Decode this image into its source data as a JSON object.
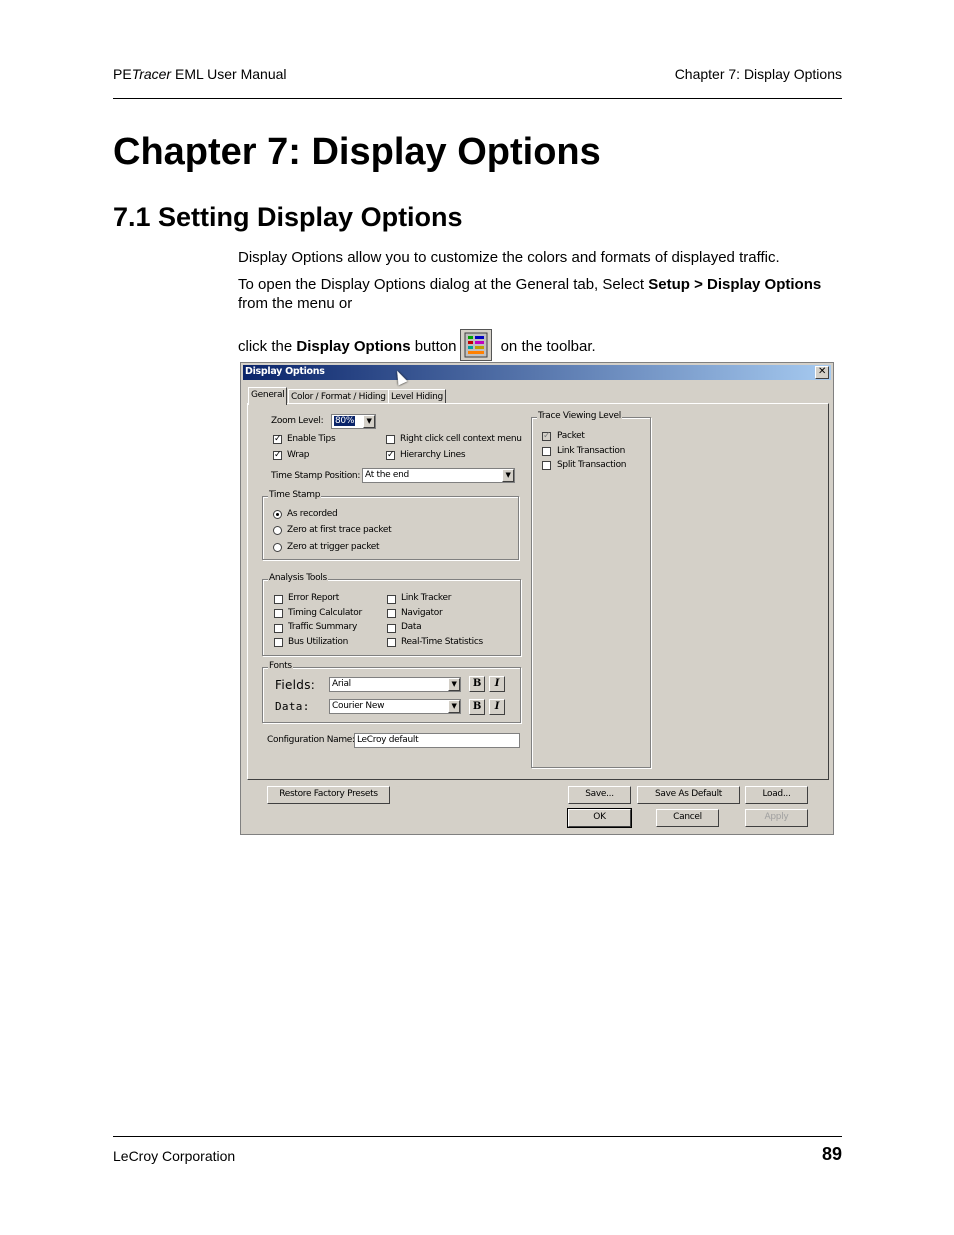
{
  "header": {
    "left_prefix": "PE",
    "left_italic": "Tracer",
    "left_suffix": " EML User Manual",
    "right": "Chapter 7: Display Options"
  },
  "chapter_title": "Chapter 7:  Display Options",
  "section_title": "7.1 Setting Display Options",
  "body": {
    "p1": "Display Options allow you to customize the colors and formats of displayed traffic.",
    "p2_a": "To open the Display Options dialog at the General tab, Select ",
    "p2_b": "Setup > Display Options",
    "p2_c": " from the menu or",
    "p3_a": "click the ",
    "p3_b": "Display Options",
    "p3_c": " button",
    "p3_d": " on the toolbar."
  },
  "dialog": {
    "title": "Display Options",
    "close": "✕",
    "tabs": [
      "General",
      "Color / Format / Hiding",
      "Level Hiding"
    ],
    "zoom_label": "Zoom Level:",
    "zoom_value": "80%",
    "checks_left": [
      {
        "label": "Enable Tips",
        "checked": true
      },
      {
        "label": "Wrap",
        "checked": true
      }
    ],
    "checks_right": [
      {
        "label": "Right click cell context menu",
        "checked": false
      },
      {
        "label": "Hierarchy Lines",
        "checked": true
      }
    ],
    "timestamp_pos_label": "Time Stamp Position:",
    "timestamp_pos_value": "At the end",
    "timestamp_group": {
      "title": "Time Stamp",
      "options": [
        {
          "label": "As recorded",
          "selected": true
        },
        {
          "label": "Zero at first trace packet",
          "selected": false
        },
        {
          "label": "Zero at trigger packet",
          "selected": false
        }
      ]
    },
    "analysis_group": {
      "title": "Analysis Tools",
      "left": [
        "Error Report",
        "Timing Calculator",
        "Traffic Summary",
        "Bus Utilization"
      ],
      "right": [
        "Link Tracker",
        "Navigator",
        "Data",
        "Real-Time Statistics"
      ]
    },
    "fonts_group": {
      "title": "Fonts",
      "fields_label": "Fields:",
      "fields_value": "Arial",
      "data_label": "Data:",
      "data_value": "Courier New",
      "bold": "B",
      "italic": "I"
    },
    "config_label": "Configuration Name:",
    "config_value": "LeCroy default",
    "trace_group": {
      "title": "Trace Viewing Level",
      "options": [
        {
          "label": "Packet",
          "checked": true,
          "disabled": true
        },
        {
          "label": "Link Transaction",
          "checked": false,
          "disabled": false
        },
        {
          "label": "Split Transaction",
          "checked": false,
          "disabled": false
        }
      ]
    },
    "buttons": {
      "restore": "Restore Factory Presets",
      "save": "Save...",
      "save_default": "Save As Default",
      "load": "Load...",
      "ok": "OK",
      "cancel": "Cancel",
      "apply": "Apply"
    }
  },
  "footer": {
    "left": "LeCroy Corporation",
    "page": "89"
  }
}
